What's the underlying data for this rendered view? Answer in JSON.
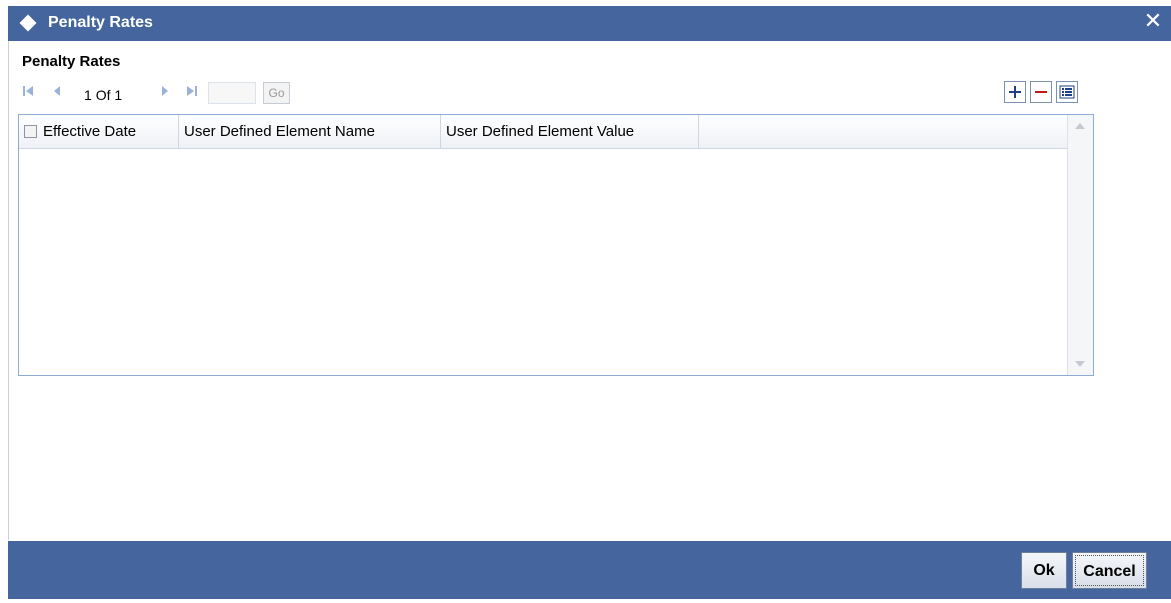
{
  "window": {
    "title": "Penalty Rates",
    "close_glyph": "✕"
  },
  "section": {
    "title": "Penalty Rates"
  },
  "pagination": {
    "first_icon": "first-page-icon",
    "prev_icon": "prev-page-icon",
    "next_icon": "next-page-icon",
    "last_icon": "last-page-icon",
    "current_page": "1",
    "of_label": "Of",
    "total_pages": "1",
    "page_input_value": "",
    "go_label": "Go"
  },
  "toolbar": {
    "add_icon": "plus-icon",
    "delete_icon": "minus-icon",
    "view_icon": "list-view-icon"
  },
  "grid": {
    "columns": [
      "Effective Date",
      "User Defined Element Name",
      "User Defined Element Value"
    ],
    "rows": []
  },
  "footer": {
    "ok_label": "Ok",
    "cancel_label": "Cancel"
  },
  "colors": {
    "titlebar": "#45659f",
    "footer": "#45659f",
    "grid_border": "#8eaad6"
  }
}
